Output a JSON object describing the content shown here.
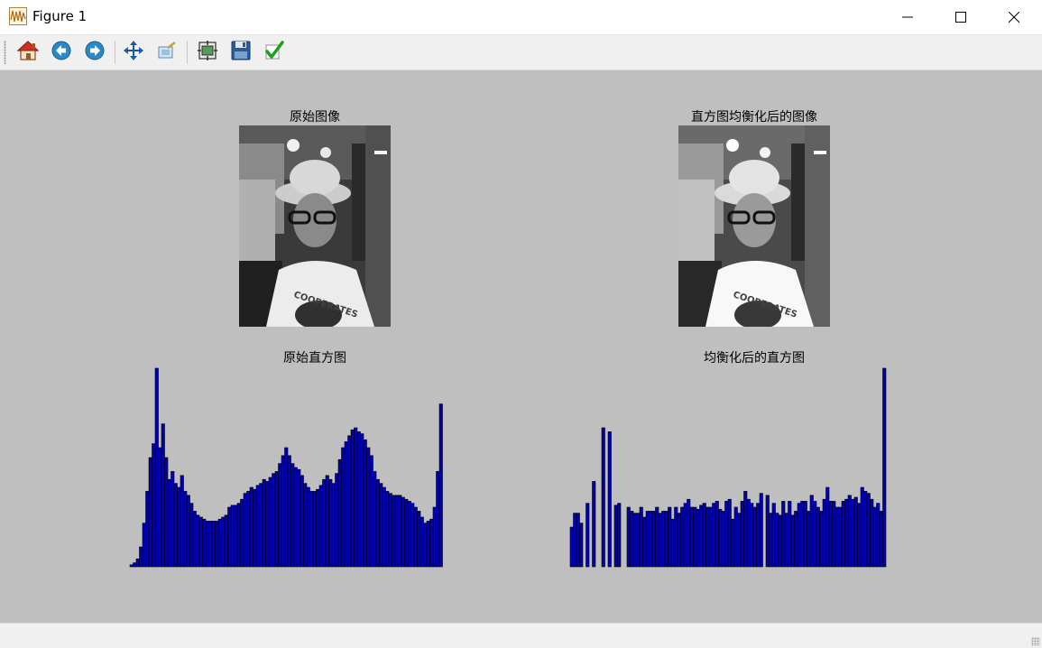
{
  "window": {
    "title": "Figure 1",
    "icons": {
      "app": "waveform-figure-icon",
      "minimize": "minimize-icon",
      "maximize": "maximize-icon",
      "close": "close-icon"
    }
  },
  "toolbar": {
    "buttons": [
      {
        "name": "home-button",
        "icon": "home-icon"
      },
      {
        "name": "back-button",
        "icon": "arrow-left-icon"
      },
      {
        "name": "forward-button",
        "icon": "arrow-right-icon"
      },
      {
        "name": "pan-button",
        "icon": "move-arrows-icon"
      },
      {
        "name": "zoom-button",
        "icon": "zoom-rect-icon"
      },
      {
        "name": "subplots-button",
        "icon": "subplots-config-icon"
      },
      {
        "name": "save-button",
        "icon": "floppy-disk-icon"
      },
      {
        "name": "edit-params-button",
        "icon": "checkmark-icon"
      }
    ]
  },
  "figure": {
    "subplots": [
      {
        "title": "原始图像",
        "content": "grayscale-photo"
      },
      {
        "title": "直方图均衡化后的图像",
        "content": "equalized-photo"
      },
      {
        "title": "原始直方图"
      },
      {
        "title": "均衡化后的直方图"
      }
    ]
  },
  "colors": {
    "bar_fill": "#0000b4",
    "bar_edge": "#000000",
    "figure_bg": "#bfbfbf"
  },
  "chart_data": [
    {
      "type": "bar",
      "title": "原始直方图",
      "bins": 100,
      "values": [
        1,
        2,
        4,
        10,
        22,
        38,
        55,
        62,
        100,
        60,
        72,
        55,
        44,
        48,
        42,
        40,
        46,
        38,
        36,
        32,
        28,
        26,
        25,
        24,
        23,
        23,
        23,
        23,
        24,
        25,
        26,
        30,
        31,
        31,
        32,
        34,
        37,
        38,
        40,
        39,
        41,
        42,
        44,
        43,
        45,
        47,
        48,
        52,
        56,
        60,
        56,
        52,
        50,
        49,
        46,
        42,
        40,
        38,
        38,
        39,
        41,
        44,
        46,
        44,
        42,
        47,
        54,
        60,
        63,
        66,
        69,
        70,
        68,
        67,
        64,
        60,
        56,
        48,
        44,
        42,
        40,
        38,
        37,
        36,
        36,
        36,
        35,
        34,
        33,
        32,
        30,
        28,
        25,
        22,
        23,
        24,
        30,
        48,
        82,
        0
      ],
      "ylim": [
        0,
        100
      ]
    },
    {
      "type": "bar",
      "title": "均衡化后的直方图",
      "bins": 100,
      "values": [
        20,
        27,
        27,
        22,
        0,
        32,
        0,
        43,
        0,
        0,
        70,
        0,
        68,
        0,
        31,
        32,
        0,
        0,
        30,
        28,
        27,
        27,
        30,
        25,
        28,
        28,
        28,
        30,
        27,
        28,
        28,
        30,
        24,
        30,
        27,
        30,
        32,
        34,
        30,
        30,
        29,
        31,
        32,
        30,
        30,
        32,
        33,
        29,
        28,
        33,
        34,
        24,
        30,
        27,
        33,
        38,
        34,
        32,
        30,
        32,
        37,
        0,
        36,
        27,
        32,
        27,
        26,
        33,
        27,
        33,
        26,
        28,
        32,
        33,
        33,
        28,
        36,
        33,
        30,
        28,
        34,
        40,
        33,
        33,
        30,
        30,
        33,
        34,
        36,
        34,
        35,
        32,
        40,
        38,
        37,
        34,
        30,
        32,
        28,
        100
      ],
      "ylim": [
        0,
        100
      ]
    }
  ]
}
